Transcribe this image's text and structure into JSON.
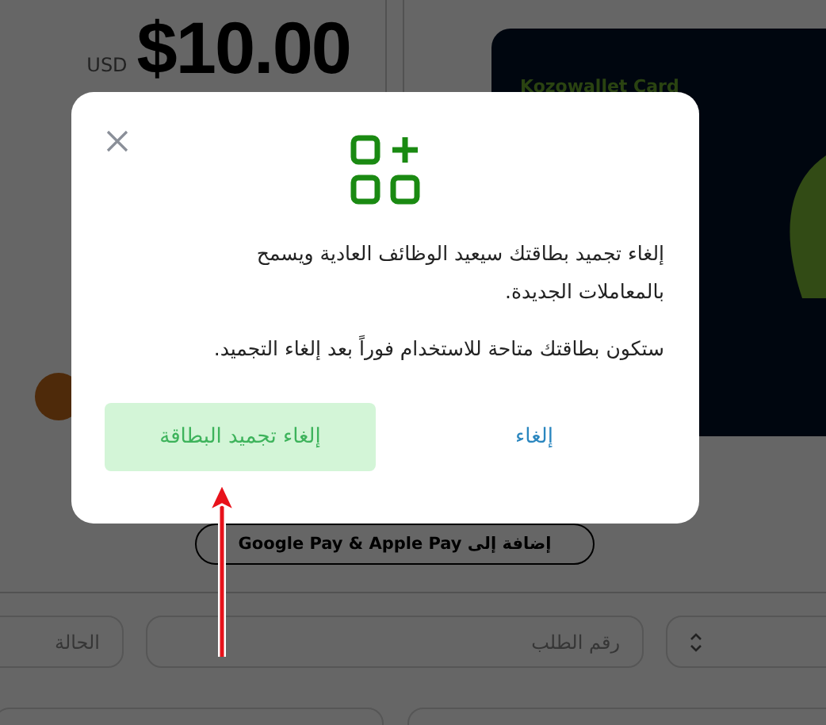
{
  "balance": {
    "currency": "USD",
    "amount": "$10.00"
  },
  "card": {
    "brand": "Kozowallet Card"
  },
  "wallet_button": "إضافة إلى Google Pay & Apple Pay",
  "filters": [
    {
      "placeholder": "رقم الطلب"
    },
    {
      "placeholder": "الحالة"
    }
  ],
  "dialog": {
    "paragraphs": [
      "إلغاء تجميد بطاقتك سيعيد الوظائف العادية ويسمح بالمعاملات الجديدة.",
      "ستكون بطاقتك متاحة للاستخدام فوراً بعد إلغاء التجميد."
    ],
    "buttons": [
      {
        "label": "إلغاء",
        "kind": "link"
      },
      {
        "label": "إلغاء تجميد البطاقة",
        "kind": "primary"
      }
    ]
  }
}
